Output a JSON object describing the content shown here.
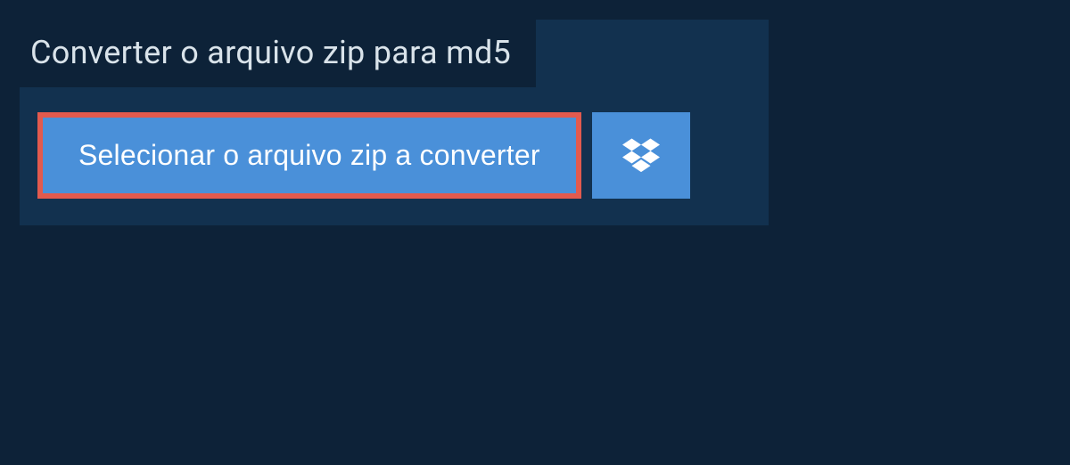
{
  "header": {
    "title": "Converter o arquivo zip para md5"
  },
  "actions": {
    "select_file_label": "Selecionar o arquivo zip a converter"
  },
  "colors": {
    "page_bg": "#0d2238",
    "panel_bg": "#12314f",
    "button_bg": "#4a90d9",
    "highlight_border": "#e25a4e",
    "text_light": "#d9e3ea"
  }
}
